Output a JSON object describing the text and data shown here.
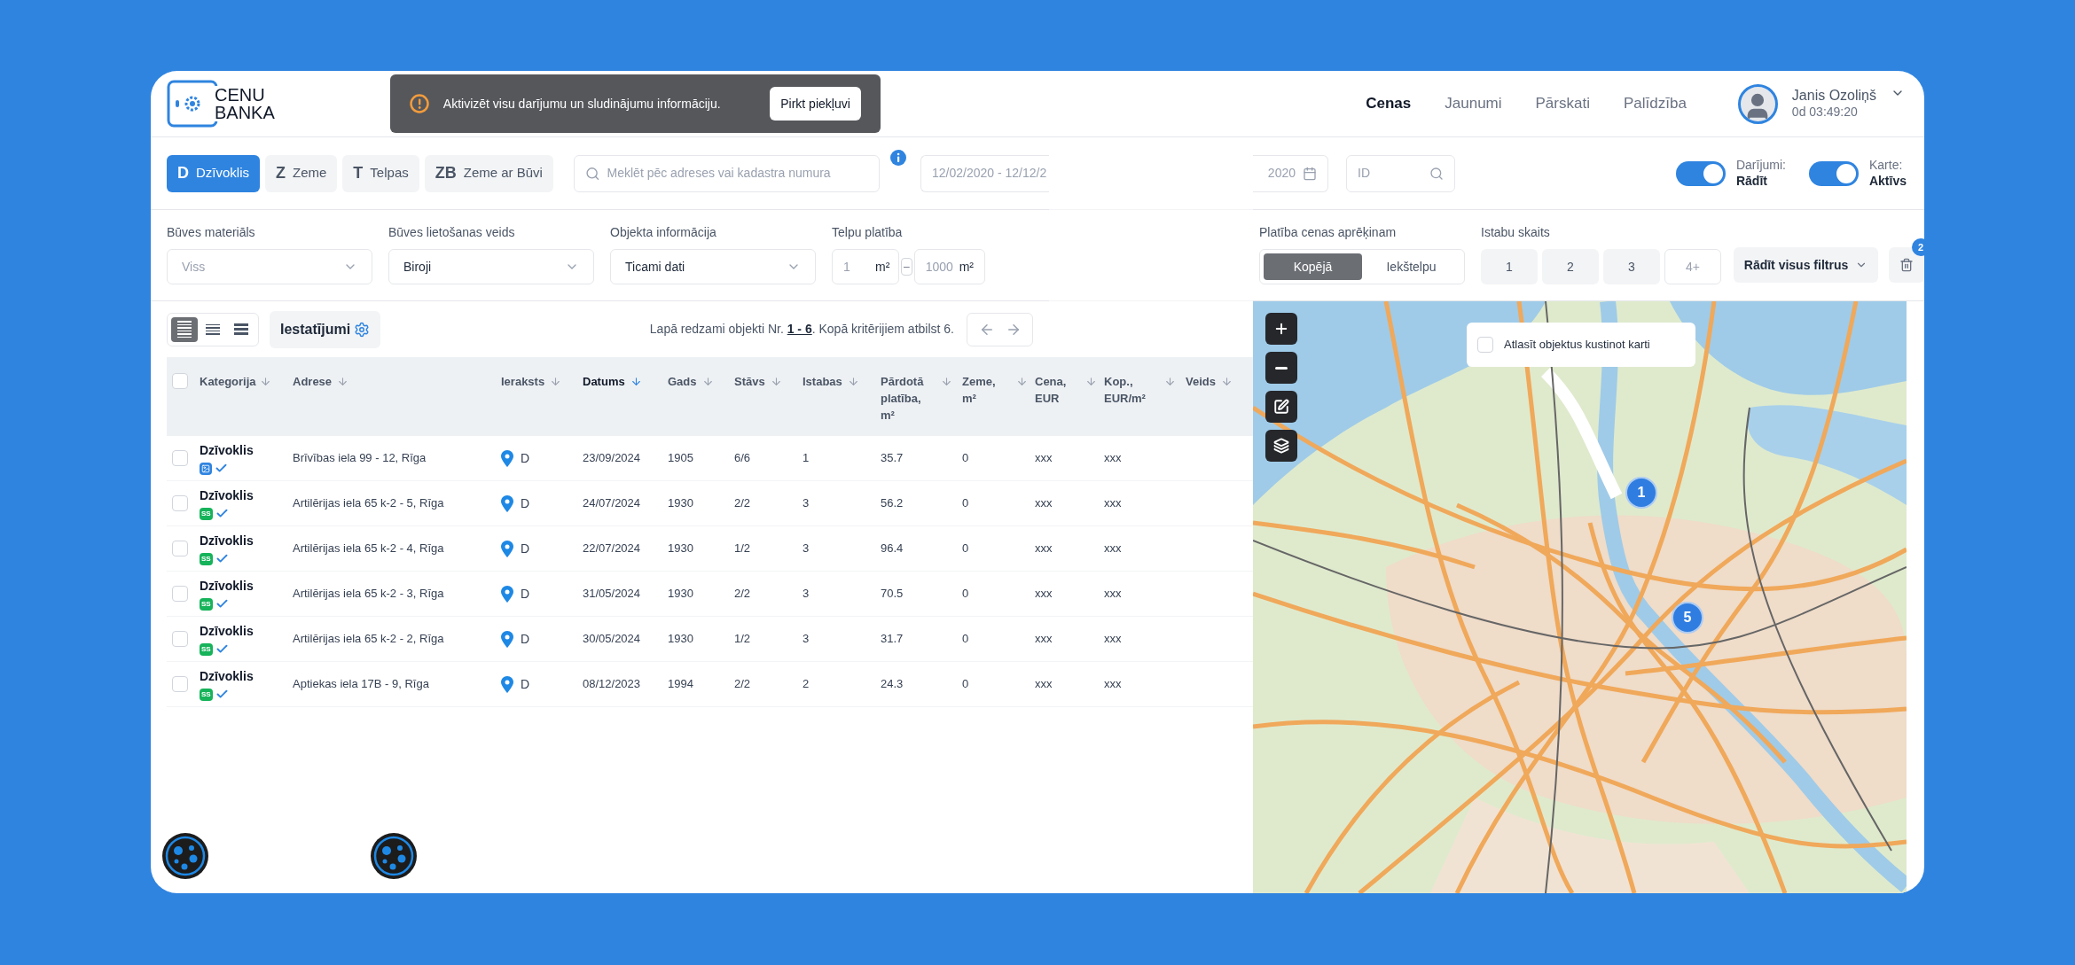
{
  "header": {
    "logo": {
      "line_1": "CENU",
      "line_2": "BANKA"
    },
    "notice": {
      "text": "Aktivizēt visu darījumu un sludinājumu informāciju.",
      "button": "Pirkt piekļuvi"
    },
    "nav": [
      {
        "label": "Cenas",
        "selected": true
      },
      {
        "label": "Jaunumi",
        "selected": false
      },
      {
        "label": "Pārskati",
        "selected": false
      },
      {
        "label": "Palīdzība",
        "selected": false
      }
    ],
    "user": {
      "name": "Janis Ozoliņš",
      "time": "0d 03:49:20"
    }
  },
  "type_tabs": [
    {
      "badge": "D",
      "label": "Dzīvoklis",
      "selected": true
    },
    {
      "badge": "Z",
      "label": "Zeme",
      "selected": false
    },
    {
      "badge": "T",
      "label": "Telpas",
      "selected": false
    },
    {
      "badge": "ZB",
      "label": "Zeme ar Būvi",
      "selected": false
    }
  ],
  "search": {
    "placeholder": "Meklēt pēc adreses vai kadastra numura"
  },
  "date_range": {
    "left_part": "12/02/2020 - 12/12/2",
    "right_part": "2020"
  },
  "id_field": {
    "placeholder": "ID"
  },
  "toggles": [
    {
      "label": "Darījumi:",
      "value": "Rādīt",
      "on": true
    },
    {
      "label": "Karte:",
      "value": "Aktīvs",
      "on": true
    }
  ],
  "filters": {
    "selects": [
      {
        "label": "Būves materiāls",
        "placeholder": "Viss"
      },
      {
        "label": "Būves lietošanas veids",
        "value": "Biroji"
      },
      {
        "label": "Objekta informācija",
        "value": "Ticami dati"
      }
    ],
    "area": {
      "label": "Telpu platība",
      "from": {
        "placeholder": "1",
        "unit": "m²"
      },
      "separator": "–",
      "to": {
        "placeholder": "1000",
        "unit": "m²"
      }
    },
    "area_basis": {
      "label": "Platība cenas aprēķinam",
      "options": [
        {
          "label": "Kopējā",
          "selected": true
        },
        {
          "label": "Iekštelpu",
          "selected": false
        }
      ]
    },
    "rooms": {
      "label": "Istabu skaits",
      "options": [
        {
          "label": "1",
          "selected": false
        },
        {
          "label": "2",
          "selected": false
        },
        {
          "label": "3",
          "selected": false
        },
        {
          "label": "4+",
          "selected": false
        }
      ]
    },
    "show_all": "Rādīt visus filtrus",
    "clear_count": "2"
  },
  "view_modes": [
    {
      "selected": true
    },
    {
      "selected": false
    },
    {
      "selected": false
    }
  ],
  "settings_button": "Iestatījumi",
  "pagination": {
    "prefix": "Lapā redzami objekti Nr. ",
    "range": "1 - 6",
    "suffix": ". Kopā kritērijiem atbilst 6."
  },
  "table": {
    "select_all_checked": false,
    "columns": [
      {
        "label": "Kategorija",
        "sort_active": false
      },
      {
        "label": "Adrese",
        "sort_active": false
      },
      {
        "label": "Ieraksts",
        "sort_active": false
      },
      {
        "label": "Datums",
        "sort_active": true
      },
      {
        "label": "Gads",
        "sort_active": false
      },
      {
        "label": "Stāvs",
        "sort_active": false
      },
      {
        "label": "Istabas",
        "sort_active": false
      },
      {
        "label": "Pārdotā platība, m²",
        "sort_active": false
      },
      {
        "label": "Zeme, m²",
        "sort_active": false
      },
      {
        "label": "Cena, EUR",
        "sort_active": false
      },
      {
        "label": "Kop., EUR/m²",
        "sort_active": false
      },
      {
        "label": "Veids",
        "sort_active": false
      }
    ],
    "rows": [
      {
        "checked": false,
        "category": "Dzīvoklis",
        "source": {
          "kind": "photo"
        },
        "verified": true,
        "address": "Brīvības iela 99 - 12, Rīga",
        "record": "D",
        "date": "23/09/2024",
        "year": "1905",
        "floor": "6/6",
        "rooms": "1",
        "area": "35.7",
        "land": "0",
        "price": "xxx",
        "price_per_m2": "xxx"
      },
      {
        "checked": false,
        "category": "Dzīvoklis",
        "source": {
          "kind": "ss",
          "label": "SS"
        },
        "verified": true,
        "address": "Artilērijas iela 65 k-2 - 5, Rīga",
        "record": "D",
        "date": "24/07/2024",
        "year": "1930",
        "floor": "2/2",
        "rooms": "3",
        "area": "56.2",
        "land": "0",
        "price": "xxx",
        "price_per_m2": "xxx"
      },
      {
        "checked": false,
        "category": "Dzīvoklis",
        "source": {
          "kind": "ss",
          "label": "SS"
        },
        "verified": true,
        "address": "Artilērijas iela 65 k-2 - 4, Rīga",
        "record": "D",
        "date": "22/07/2024",
        "year": "1930",
        "floor": "1/2",
        "rooms": "3",
        "area": "96.4",
        "land": "0",
        "price": "xxx",
        "price_per_m2": "xxx"
      },
      {
        "checked": false,
        "category": "Dzīvoklis",
        "source": {
          "kind": "ss",
          "label": "SS"
        },
        "verified": true,
        "address": "Artilērijas iela 65 k-2 - 3, Rīga",
        "record": "D",
        "date": "31/05/2024",
        "year": "1930",
        "floor": "2/2",
        "rooms": "3",
        "area": "70.5",
        "land": "0",
        "price": "xxx",
        "price_per_m2": "xxx"
      },
      {
        "checked": false,
        "category": "Dzīvoklis",
        "source": {
          "kind": "ss",
          "label": "SS"
        },
        "verified": true,
        "address": "Artilērijas iela 65 k-2 - 2, Rīga",
        "record": "D",
        "date": "30/05/2024",
        "year": "1930",
        "floor": "1/2",
        "rooms": "3",
        "area": "31.7",
        "land": "0",
        "price": "xxx",
        "price_per_m2": "xxx"
      },
      {
        "checked": false,
        "category": "Dzīvoklis",
        "source": {
          "kind": "ss",
          "label": "SS"
        },
        "verified": true,
        "address": "Aptiekas iela 17B - 9, Rīga",
        "record": "D",
        "date": "08/12/2023",
        "year": "1994",
        "floor": "2/2",
        "rooms": "2",
        "area": "24.3",
        "land": "0",
        "price": "xxx",
        "price_per_m2": "xxx"
      }
    ]
  },
  "map": {
    "move_select": {
      "label": "Atlasīt objektus kustinot karti",
      "checked": false
    },
    "clusters": [
      {
        "count": "1"
      },
      {
        "count": "5"
      }
    ]
  }
}
